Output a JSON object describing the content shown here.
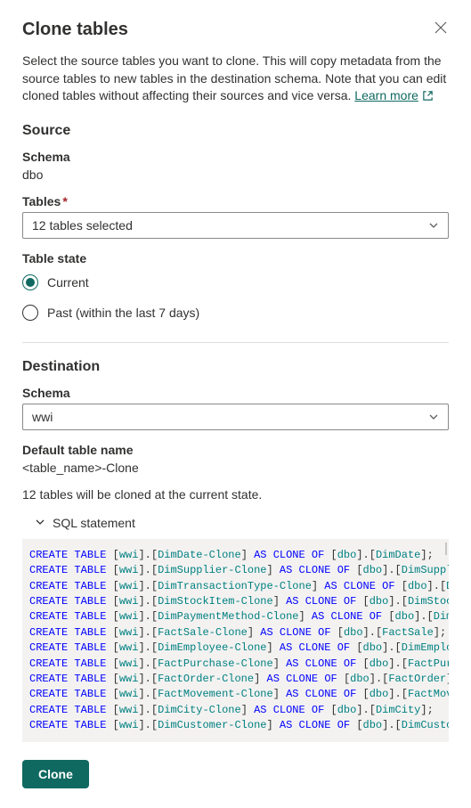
{
  "header": {
    "title": "Clone tables"
  },
  "intro": {
    "text": "Select the source tables you want to clone. This will copy metadata from the source tables to new tables in the destination schema. Note that you can edit cloned tables without affecting their sources and vice versa. ",
    "learn_more": "Learn more"
  },
  "source": {
    "heading": "Source",
    "schema_label": "Schema",
    "schema_value": "dbo",
    "tables_label": "Tables",
    "tables_selected": "12 tables selected",
    "table_state_label": "Table state",
    "radio_current": "Current",
    "radio_past": "Past (within the last 7 days)"
  },
  "destination": {
    "heading": "Destination",
    "schema_label": "Schema",
    "schema_value": "wwi",
    "default_name_label": "Default table name",
    "default_name_value": "<table_name>-Clone"
  },
  "status": {
    "line": "12 tables will be cloned at the current state."
  },
  "sql": {
    "header": "SQL statement",
    "kw_create": "CREATE",
    "kw_table": "TABLE",
    "kw_as": "AS",
    "kw_clone": "CLONE",
    "kw_of": "OF",
    "statements": [
      {
        "dest_schema": "wwi",
        "dest_table": "DimDate-Clone",
        "src_schema": "dbo",
        "src_table": "DimDate"
      },
      {
        "dest_schema": "wwi",
        "dest_table": "DimSupplier-Clone",
        "src_schema": "dbo",
        "src_table": "DimSupplier"
      },
      {
        "dest_schema": "wwi",
        "dest_table": "DimTransactionType-Clone",
        "src_schema": "dbo",
        "src_table": "DimTra"
      },
      {
        "dest_schema": "wwi",
        "dest_table": "DimStockItem-Clone",
        "src_schema": "dbo",
        "src_table": "DimStockItem"
      },
      {
        "dest_schema": "wwi",
        "dest_table": "DimPaymentMethod-Clone",
        "src_schema": "dbo",
        "src_table": "DimPayme"
      },
      {
        "dest_schema": "wwi",
        "dest_table": "FactSale-Clone",
        "src_schema": "dbo",
        "src_table": "FactSale"
      },
      {
        "dest_schema": "wwi",
        "dest_table": "DimEmployee-Clone",
        "src_schema": "dbo",
        "src_table": "DimEmployee"
      },
      {
        "dest_schema": "wwi",
        "dest_table": "FactPurchase-Clone",
        "src_schema": "dbo",
        "src_table": "FactPurchase"
      },
      {
        "dest_schema": "wwi",
        "dest_table": "FactOrder-Clone",
        "src_schema": "dbo",
        "src_table": "FactOrder"
      },
      {
        "dest_schema": "wwi",
        "dest_table": "FactMovement-Clone",
        "src_schema": "dbo",
        "src_table": "FactMovement"
      },
      {
        "dest_schema": "wwi",
        "dest_table": "DimCity-Clone",
        "src_schema": "dbo",
        "src_table": "DimCity"
      },
      {
        "dest_schema": "wwi",
        "dest_table": "DimCustomer-Clone",
        "src_schema": "dbo",
        "src_table": "DimCustomer"
      }
    ]
  },
  "actions": {
    "clone": "Clone"
  }
}
